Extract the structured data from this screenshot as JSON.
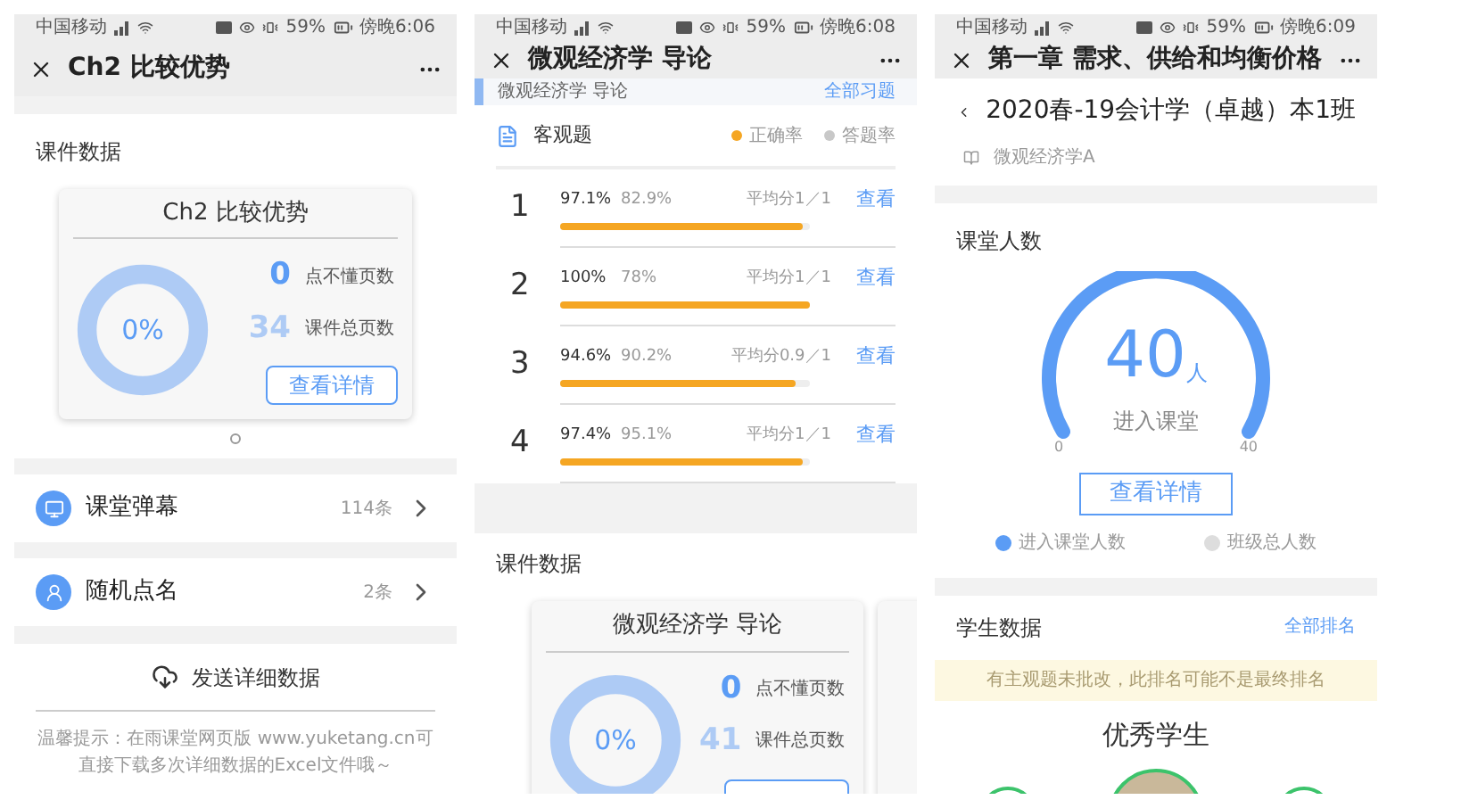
{
  "screens": [
    {
      "kind": "courseware",
      "status_bar": {
        "carrier": "中国移动",
        "battery": "59%",
        "time": "傍晚6:06"
      },
      "title": "Ch2 比较优势",
      "section_title": "课件数据",
      "card": {
        "title": "Ch2 比较优势",
        "percent": "0%",
        "stats": [
          {
            "value": "0",
            "label": "点不懂页数"
          },
          {
            "value": "34",
            "label": "课件总页数"
          }
        ],
        "button": "查看详情"
      },
      "list": [
        {
          "kind": "danmaku",
          "label": "课堂弹幕",
          "count": "114条"
        },
        {
          "kind": "rollcall",
          "label": "随机点名",
          "count": "2条"
        }
      ],
      "send_button": "发送详细数据",
      "tip": "温馨提示：在雨课堂网页版 www.yuketang.cn可直接下载多次详细数据的Excel文件哦～"
    },
    {
      "kind": "exercise",
      "status_bar": {
        "carrier": "中国移动",
        "battery": "59%",
        "time": "傍晚6:08"
      },
      "title": "微观经济学 导论",
      "header": {
        "title": "微观经济学 导论",
        "link": "全部习题"
      },
      "objective": {
        "title": "客观题",
        "legend": [
          {
            "label": "正确率",
            "color": "#f5a623"
          },
          {
            "label": "答题率",
            "color": "#c8c8c8"
          }
        ]
      },
      "rows": [
        {
          "number": "1",
          "correct": "97.1%",
          "answered": "82.9%",
          "average": "平均分1／1",
          "link": "查看",
          "level": 0.971
        },
        {
          "number": "2",
          "correct": "100%",
          "answered": "78%",
          "average": "平均分1／1",
          "link": "查看",
          "level": 1
        },
        {
          "number": "3",
          "correct": "94.6%",
          "answered": "90.2%",
          "average": "平均分0.9／1",
          "link": "查看",
          "level": 0.946
        },
        {
          "number": "4",
          "correct": "97.4%",
          "answered": "95.1%",
          "average": "平均分1／1",
          "link": "查看",
          "level": 0.974
        }
      ],
      "section_title": "课件数据",
      "card": {
        "title": "微观经济学 导论",
        "percent": "0%",
        "stats": [
          {
            "value": "0",
            "label": "点不懂页数"
          },
          {
            "value": "41",
            "label": "课件总页数"
          }
        ]
      }
    },
    {
      "kind": "classroom",
      "status_bar": {
        "carrier": "中国移动",
        "battery": "59%",
        "time": "傍晚6:09"
      },
      "title": "第一章 需求、供给和均衡价格",
      "class_name": "2020春-19会计学（卓越）本1班",
      "course": "微观经济学A",
      "section_title": "课堂人数",
      "gauge": {
        "value": "40",
        "unit": "人",
        "caption": "进入课堂",
        "min": "0",
        "max": "40",
        "level": 1
      },
      "button": "查看详情",
      "legend": [
        {
          "label": "进入课堂人数",
          "color": "#5b9cf5"
        },
        {
          "label": "班级总人数",
          "color": "#dddddd"
        }
      ],
      "students_title": "学生数据",
      "students_link": "全部排名",
      "notice": "有主观题未批改，此排名可能不是最终排名",
      "top_title": "优秀学生"
    }
  ]
}
